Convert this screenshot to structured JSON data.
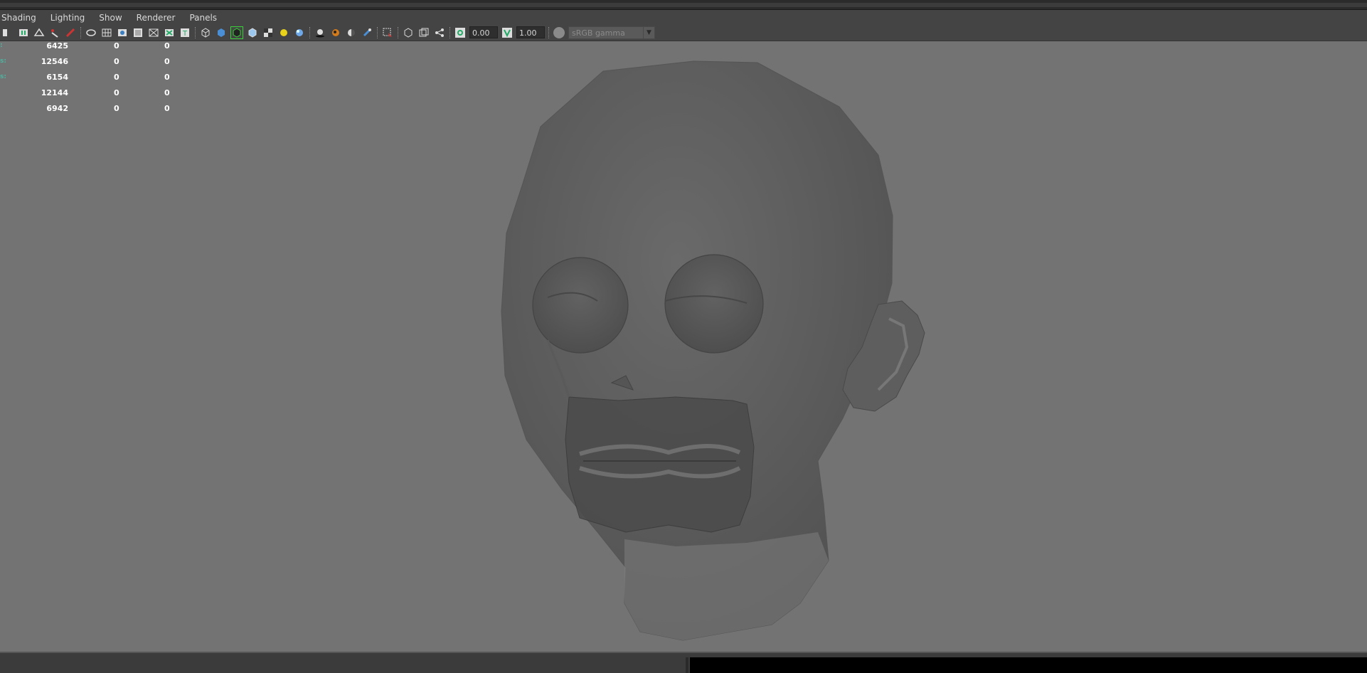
{
  "menu": {
    "items": [
      {
        "label": "Shading"
      },
      {
        "label": "Lighting"
      },
      {
        "label": "Show"
      },
      {
        "label": "Renderer"
      },
      {
        "label": "Panels"
      }
    ]
  },
  "toolbar": {
    "exposure_value": "0.00",
    "gamma_value": "1.00",
    "color_space": "sRGB gamma"
  },
  "hud": {
    "rows": [
      {
        "label": ":",
        "values": [
          "6425",
          "0",
          "0"
        ]
      },
      {
        "label": "s:",
        "values": [
          "12546",
          "0",
          "0"
        ]
      },
      {
        "label": "s:",
        "values": [
          "6154",
          "0",
          "0"
        ]
      },
      {
        "label": "",
        "values": [
          "12144",
          "0",
          "0"
        ]
      },
      {
        "label": "",
        "values": [
          "6942",
          "0",
          "0"
        ]
      }
    ]
  },
  "colors": {
    "viewport_bg": "#737373",
    "menubar_bg": "#444444",
    "hud_label": "#4fb3a0"
  }
}
